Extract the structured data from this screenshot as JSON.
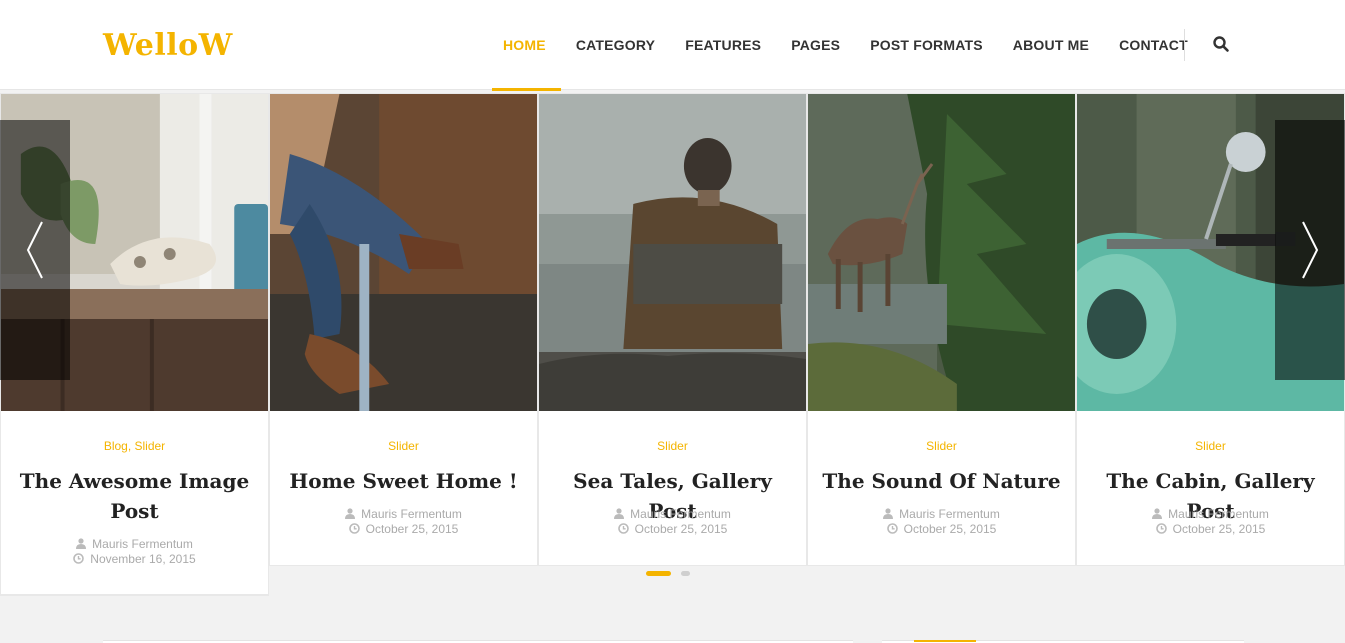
{
  "logo": "WelloW",
  "nav": [
    "HOME",
    "CATEGORY",
    "FEATURES",
    "PAGES",
    "POST FORMATS",
    "ABOUT ME",
    "CONTACT"
  ],
  "accent_color": "#f4b400",
  "search_icon": "search-icon",
  "slides": [
    {
      "category": "Blog, Slider",
      "title": "The Awesome Image Post",
      "author": "Mauris Fermentum",
      "date": "November 16, 2015"
    },
    {
      "category": "Slider",
      "title": "Home Sweet Home !",
      "author": "Mauris Fermentum",
      "date": "October 25, 2015"
    },
    {
      "category": "Slider",
      "title": "Sea Tales, Gallery Post",
      "author": "Mauris Fermentum",
      "date": "October 25, 2015"
    },
    {
      "category": "Slider",
      "title": "The Sound Of Nature",
      "author": "Mauris Fermentum",
      "date": "October 25, 2015"
    },
    {
      "category": "Slider",
      "title": "The Cabin, Gallery Post",
      "author": "Mauris Fermentum",
      "date": "October 25, 2015"
    }
  ],
  "slider_nav": {
    "prev_icon": "chevron-left-icon",
    "next_icon": "chevron-right-icon"
  },
  "pagination": {
    "pages": 2,
    "current": 1
  }
}
